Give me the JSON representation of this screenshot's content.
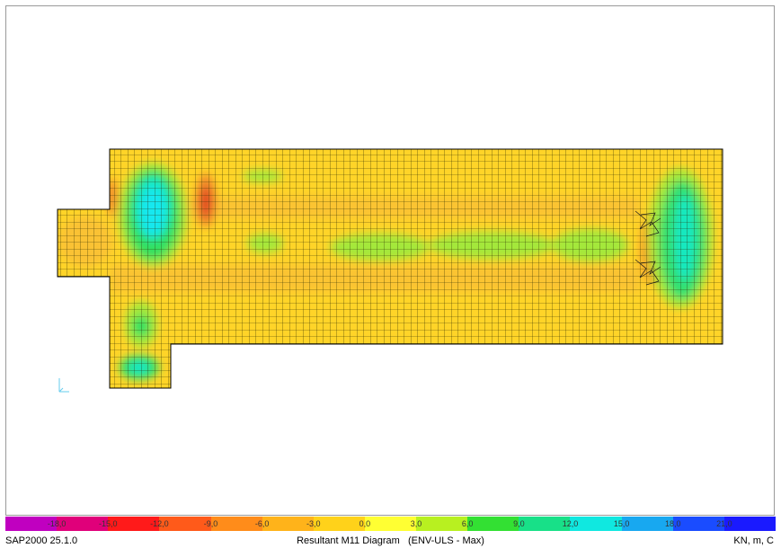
{
  "app": {
    "version_label": "SAP2000 25.1.0"
  },
  "diagram": {
    "title": "Resultant M11 Diagram   (ENV-ULS - Max)"
  },
  "units": {
    "label": "KN, m, C"
  },
  "legend": {
    "ticks": [
      "-18,0",
      "-15,0",
      "-12,0",
      "-9,0",
      "-6,0",
      "-3,0",
      "0,0",
      "3,0",
      "6,0",
      "9,0",
      "12,0",
      "15,0",
      "18,0",
      "21,0"
    ],
    "colors": [
      "#c000c0",
      "#e0007a",
      "#ff1a1a",
      "#ff5a1a",
      "#ff8c1a",
      "#ffb31a",
      "#ffd21a",
      "#ffff33",
      "#b8f020",
      "#33e033",
      "#18e088",
      "#10e8e0",
      "#18a8f0",
      "#1a4cff",
      "#1a1aff"
    ]
  }
}
